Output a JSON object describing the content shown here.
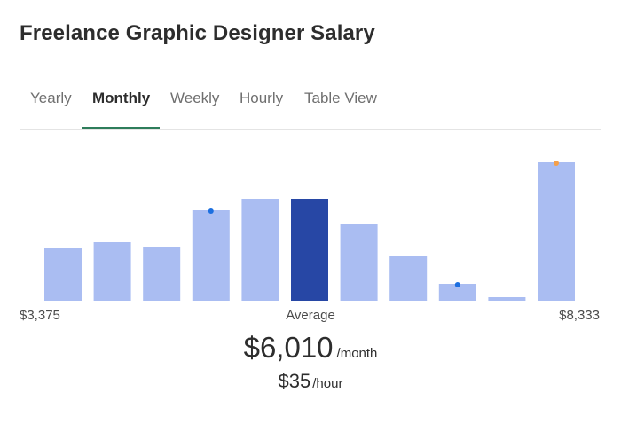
{
  "title": "Freelance Graphic Designer Salary",
  "tabs": [
    {
      "label": "Yearly",
      "active": false
    },
    {
      "label": "Monthly",
      "active": true
    },
    {
      "label": "Weekly",
      "active": false
    },
    {
      "label": "Hourly",
      "active": false
    },
    {
      "label": "Table View",
      "active": false
    }
  ],
  "colors": {
    "bar": "#aabdf2",
    "bar_highlight": "#2747a5",
    "marker_blue": "#1c6fe0",
    "marker_orange": "#f5a04a",
    "active_tab_underline": "#2e7d5b"
  },
  "chart_data": {
    "type": "bar",
    "values": [
      59,
      66,
      61,
      102,
      115,
      115,
      86,
      50,
      19,
      4,
      156
    ],
    "highlight_index": 5,
    "markers": [
      {
        "index": 3,
        "color": "blue"
      },
      {
        "index": 8,
        "color": "blue"
      },
      {
        "index": 10,
        "color": "orange"
      }
    ],
    "min_label": "$3,375",
    "max_label": "$8,333",
    "average_label": "Average"
  },
  "salary": {
    "primary_value": "$6,010",
    "primary_unit": "/month",
    "secondary_value": "$35",
    "secondary_unit": "/hour"
  }
}
